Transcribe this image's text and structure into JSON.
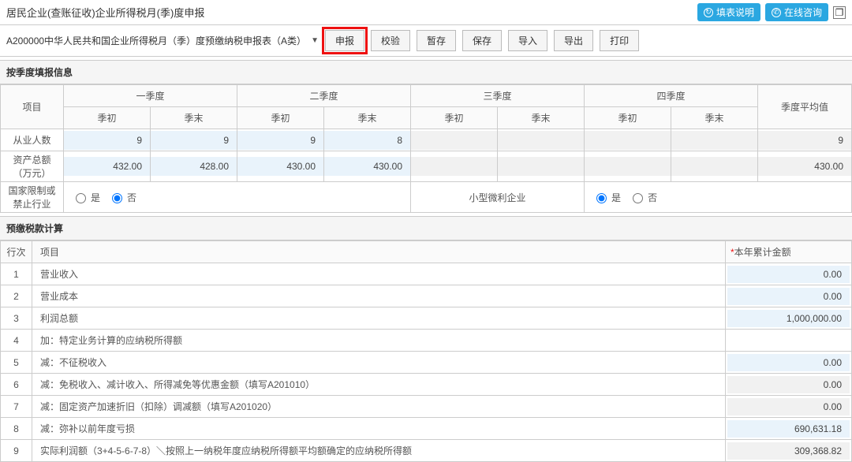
{
  "header": {
    "title": "居民企业(查账征收)企业所得税月(季)度申报",
    "help_label": "填表说明",
    "consult_label": "在线咨询"
  },
  "toolbar": {
    "dropdown_label": "A200000中华人民共和国企业所得税月（季）度预缴纳税申报表（A类）",
    "submit_label": "申报",
    "verify_label": "校验",
    "stash_label": "暂存",
    "save_label": "保存",
    "import_label": "导入",
    "export_label": "导出",
    "print_label": "打印"
  },
  "quarter": {
    "section_title": "按季度填报信息",
    "project_label": "项目",
    "q1": "一季度",
    "q2": "二季度",
    "q3": "三季度",
    "q4": "四季度",
    "qstart": "季初",
    "qend": "季末",
    "avg_label": "季度平均值",
    "row_emp": "从业人数",
    "row_asset": "资产总额（万元）",
    "row_restrict": "国家限制或禁止行业",
    "row_small": "小型微利企业",
    "yes": "是",
    "no": "否",
    "emp": {
      "q1s": "9",
      "q1e": "9",
      "q2s": "9",
      "q2e": "8",
      "avg": "9"
    },
    "asset": {
      "q1s": "432.00",
      "q1e": "428.00",
      "q2s": "430.00",
      "q2e": "430.00",
      "avg": "430.00"
    }
  },
  "tax": {
    "section_title": "预缴税款计算",
    "col_row": "行次",
    "col_item": "项目",
    "col_amt": "本年累计金额",
    "rows": [
      {
        "n": "1",
        "item": "营业收入",
        "amt": "0.00",
        "grey": false
      },
      {
        "n": "2",
        "item": "营业成本",
        "amt": "0.00",
        "grey": false
      },
      {
        "n": "3",
        "item": "利润总额",
        "amt": "1,000,000.00",
        "grey": false
      },
      {
        "n": "4",
        "item": "加：特定业务计算的应纳税所得额",
        "amt": "",
        "grey": false,
        "empty": true
      },
      {
        "n": "5",
        "item": "减：不征税收入",
        "amt": "0.00",
        "grey": false
      },
      {
        "n": "6",
        "item": "减：免税收入、减计收入、所得减免等优惠金额（填写A201010）",
        "amt": "0.00",
        "grey": true
      },
      {
        "n": "7",
        "item": "减：固定资产加速折旧（扣除）调减额（填写A201020）",
        "amt": "0.00",
        "grey": true
      },
      {
        "n": "8",
        "item": "减：弥补以前年度亏损",
        "amt": "690,631.18",
        "grey": false
      },
      {
        "n": "9",
        "item": "实际利润额（3+4-5-6-7-8）＼按照上一纳税年度应纳税所得额平均额确定的应纳税所得额",
        "amt": "309,368.82",
        "grey": true
      }
    ]
  }
}
